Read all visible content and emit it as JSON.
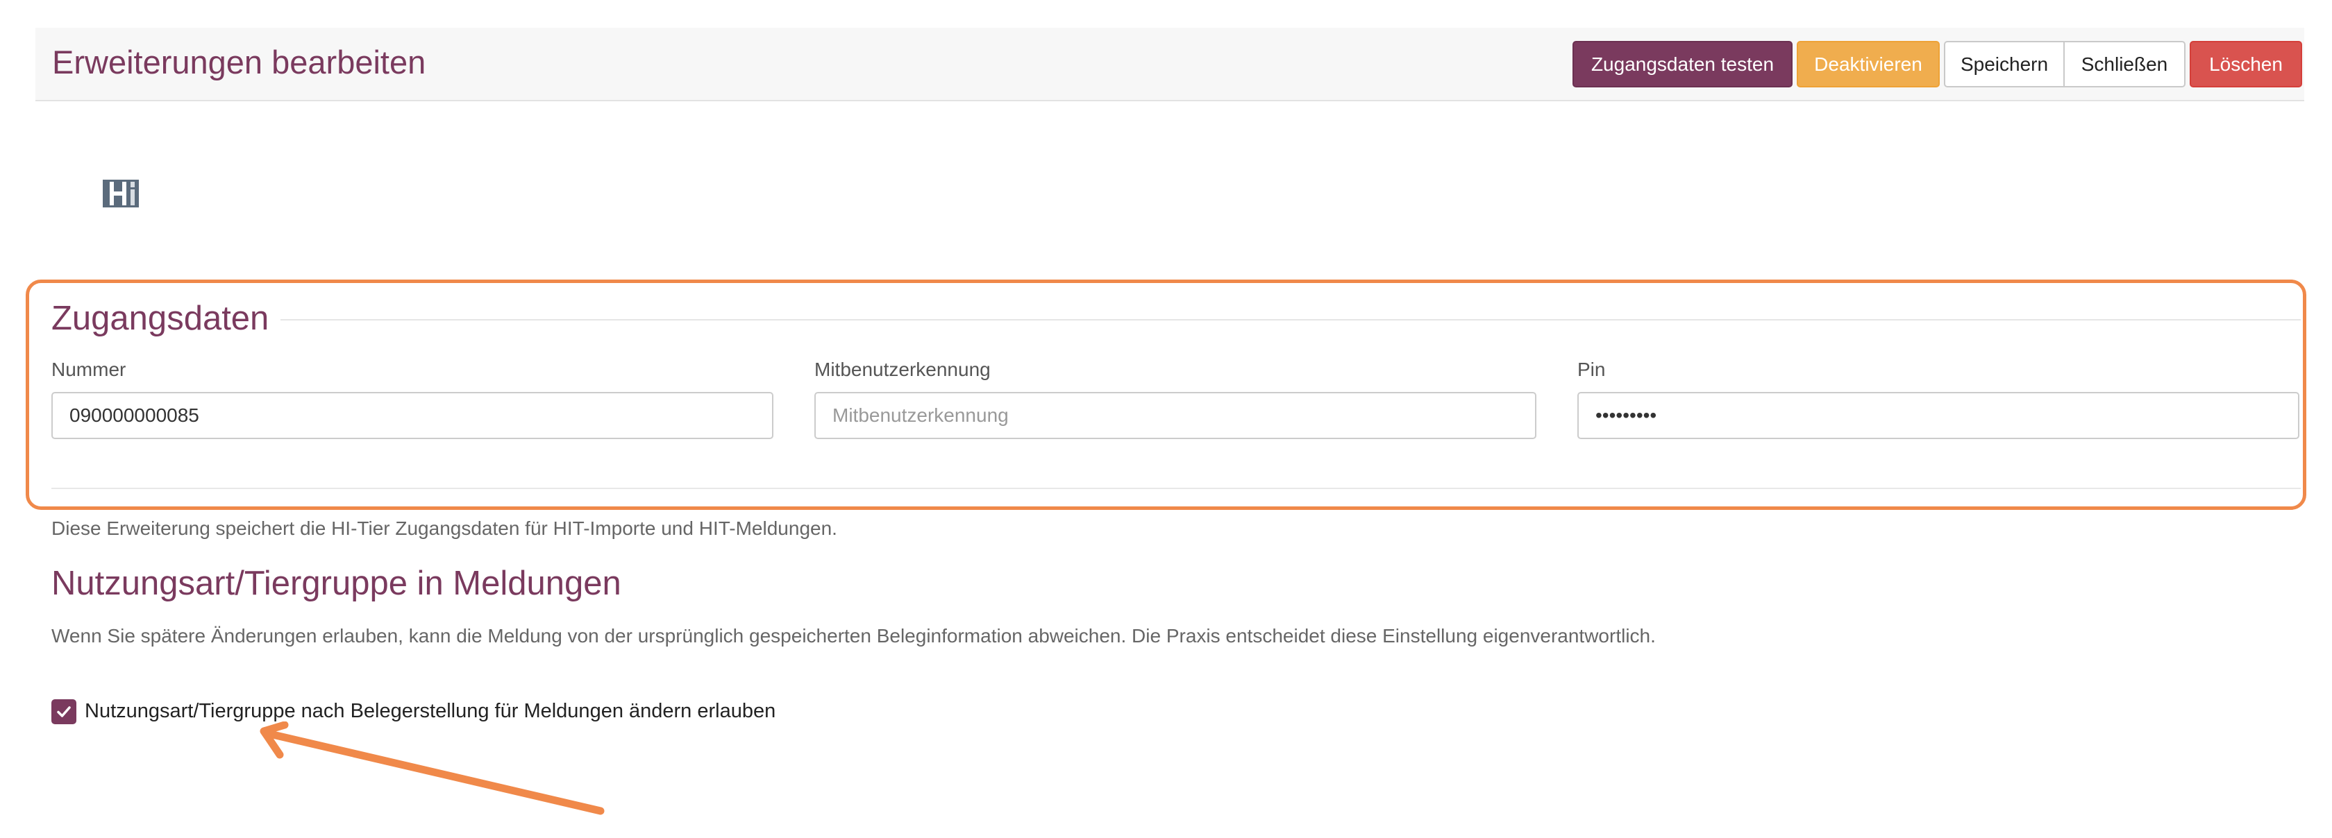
{
  "header": {
    "title": "Erweiterungen bearbeiten",
    "buttons": {
      "test": "Zugangsdaten testen",
      "deactivate": "Deaktivieren",
      "save": "Speichern",
      "close": "Schließen",
      "delete": "Löschen"
    }
  },
  "logo": {
    "icon": "hi-tier-logo-icon"
  },
  "credentials": {
    "title": "Zugangsdaten",
    "nummer": {
      "label": "Nummer",
      "value": "090000000085"
    },
    "mitbenutzer": {
      "label": "Mitbenutzerkennung",
      "value": "",
      "placeholder": "Mitbenutzerkennung"
    },
    "pin": {
      "label": "Pin",
      "value": "•••••••••"
    },
    "help_text": "Diese Erweiterung speichert die HI-Tier Zugangsdaten für HIT-Importe und HIT-Meldungen."
  },
  "usage": {
    "title": "Nutzungsart/Tiergruppe in Meldungen",
    "description": "Wenn Sie spätere Änderungen erlauben, kann die Meldung von der ursprünglich gespeicherten Beleginformation abweichen. Die Praxis entscheidet diese Einstellung eigenverantwortlich.",
    "checkbox_label": "Nutzungsart/Tiergruppe nach Belegerstellung für Meldungen ändern erlauben",
    "checkbox_checked": true
  },
  "colors": {
    "accent": "#7a3a5e",
    "warning": "#f0ad4e",
    "danger": "#d9534f",
    "annotation": "#f0894a"
  }
}
